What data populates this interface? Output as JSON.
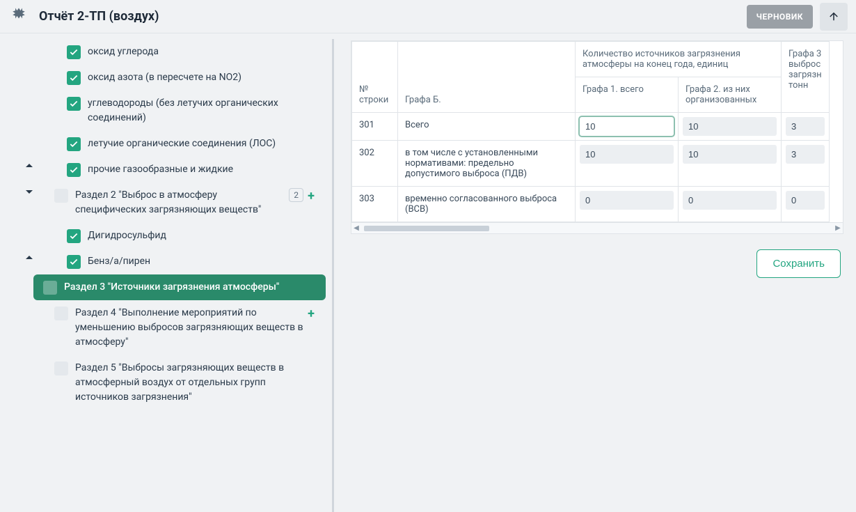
{
  "header": {
    "title": "Отчёт 2-ТП (воздух)",
    "draft_badge": "ЧЕРНОВИК"
  },
  "sidebar": {
    "items": [
      {
        "type": "leaf",
        "checked": true,
        "label": "оксид углерода"
      },
      {
        "type": "leaf",
        "checked": true,
        "label": "оксид азота (в пересчете на NO2)"
      },
      {
        "type": "leaf",
        "checked": true,
        "label": "углеводороды (без летучих органических соединений)"
      },
      {
        "type": "leaf",
        "checked": true,
        "label": "летучие органические соединения (ЛОС)"
      },
      {
        "type": "leaf-caret",
        "caret": "up",
        "checked": true,
        "label": "прочие газообразные и жидкие"
      },
      {
        "type": "section",
        "caret": "down",
        "checked": false,
        "label": "Раздел 2 \"Выброс в атмосферу специфических загрязняющих веществ\"",
        "count": "2",
        "add": true
      },
      {
        "type": "child",
        "checked": true,
        "label": "Дигидросульфид"
      },
      {
        "type": "child-caret",
        "caret": "up",
        "checked": true,
        "label": "Бенз/а/пирен"
      },
      {
        "type": "active",
        "checked": false,
        "label": "Раздел 3 \"Источники загрязнения атмосферы\""
      },
      {
        "type": "section-noexp",
        "checked": false,
        "label": "Раздел 4 \"Выполнение мероприятий по уменьшению выбросов загрязняющих веществ в атмосферу\"",
        "add": true
      },
      {
        "type": "section-noexp",
        "checked": false,
        "label": "Раздел 5 \"Выбросы загрязняющих веществ в атмосферный воздух от отдельных групп источников загрязнения\""
      }
    ]
  },
  "table": {
    "group_header": "Количество источников загрязнения атмосферы на конец года, единиц",
    "col_num": "№ строки",
    "col_b": "Графа Б.",
    "col_g1": "Графа 1. всего",
    "col_g2": "Графа 2. из них организованных",
    "col_g3": "Графа 3 выброс загрязн тонн",
    "rows": [
      {
        "num": "301",
        "b": "Всего",
        "g1": "10",
        "g2": "10",
        "g3": "3",
        "g1_focus": true
      },
      {
        "num": "302",
        "b": "в том числе с установленными нормативами: предельно допустимого выброса (ПДВ)",
        "g1": "10",
        "g2": "10",
        "g3": "3"
      },
      {
        "num": "303",
        "b": "временно согласованного выброса (ВСВ)",
        "g1": "0",
        "g2": "0",
        "g3": "0"
      }
    ]
  },
  "buttons": {
    "save": "Сохранить"
  }
}
